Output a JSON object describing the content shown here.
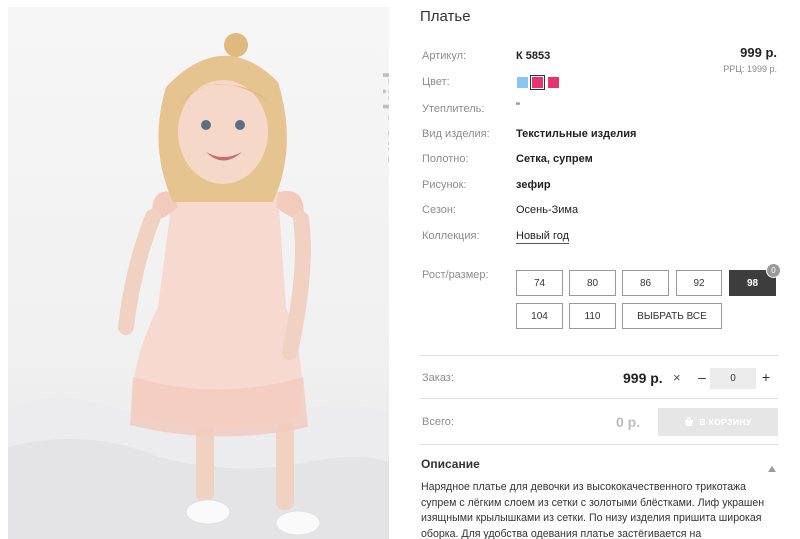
{
  "product": {
    "title": "Платье",
    "price": "999 р.",
    "rrp": "РРЦ: 1999 р."
  },
  "brand": {
    "logo_text": "crockid"
  },
  "specs": {
    "article_label": "Артикул:",
    "article_value": "К 5853",
    "color_label": "Цвет:",
    "insulation_label": "Утеплитель:",
    "insulation_value": "\"",
    "type_label": "Вид изделия:",
    "type_value": "Текстильные изделия",
    "fabric_label": "Полотно:",
    "fabric_value": "Сетка, супрем",
    "pattern_label": "Рисунок:",
    "pattern_value": "зефир",
    "season_label": "Сезон:",
    "season_value": "Осень-Зима",
    "collection_label": "Коллекция:",
    "collection_value": "Новый год"
  },
  "colors": [
    {
      "hex": "#8ac6f2",
      "selected": false
    },
    {
      "hex": "#e8336d",
      "selected": true
    },
    {
      "hex": "#e8336d",
      "selected": false
    }
  ],
  "sizes": {
    "label": "Рост/размер:",
    "options": [
      "74",
      "80",
      "86",
      "92",
      "98",
      "104",
      "110"
    ],
    "selected": "98",
    "select_all_label": "ВЫБРАТЬ ВСЕ",
    "badge_count": "0"
  },
  "order": {
    "label": "Заказ:",
    "price": "999 р.",
    "times": "×",
    "minus": "–",
    "quantity": "0",
    "plus": "+"
  },
  "total": {
    "label": "Всего:",
    "value": "0 р.",
    "cart_button_label": "В КОРЗИНУ"
  },
  "description": {
    "heading": "Описание",
    "text": "Нарядное платье для девочки из высококачественного трикотажа супрем с лёгким слоем из сетки с золотыми блёстками. Лиф украшен изящными крылышками из сетки. По низу изделия пришита широкая оборка. Для удобства одевания платье застёгивается на"
  },
  "theme": {
    "accent_dark": "#3d3d3d",
    "muted_label": "#8c8c8c",
    "disabled_button": "#e6e6e6"
  }
}
